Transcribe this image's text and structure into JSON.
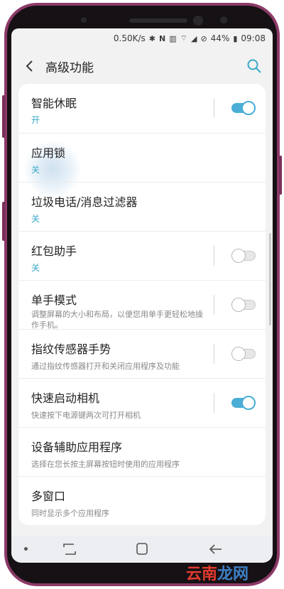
{
  "status_bar": {
    "speed": "0.50K/s",
    "battery": "44%",
    "time": "09:08"
  },
  "app_bar": {
    "title": "高级功能"
  },
  "settings": [
    {
      "title": "智能休眠",
      "subtitle": "开",
      "subtitle_style": "value",
      "toggle": "on"
    },
    {
      "title": "应用锁",
      "subtitle": "关",
      "subtitle_style": "value",
      "toggle": null
    },
    {
      "title": "垃圾电话/消息过滤器",
      "subtitle": "关",
      "subtitle_style": "value",
      "toggle": null
    },
    {
      "title": "红包助手",
      "subtitle": "关",
      "subtitle_style": "value",
      "toggle": "off"
    },
    {
      "title": "单手模式",
      "subtitle": "调整屏幕的大小和布局，以便您用单手更轻松地操作手机。",
      "subtitle_style": "desc",
      "toggle": "off"
    },
    {
      "title": "指纹传感器手势",
      "subtitle": "通过指纹传感器打开和关闭应用程序及功能",
      "subtitle_style": "desc",
      "toggle": "off"
    },
    {
      "title": "快速启动相机",
      "subtitle": "快速按下电源键两次可打开相机",
      "subtitle_style": "desc",
      "toggle": "on"
    },
    {
      "title": "设备辅助应用程序",
      "subtitle": "选择在您长按主屏幕按钮时使用的应用程序",
      "subtitle_style": "desc",
      "toggle": null
    },
    {
      "title": "多窗口",
      "subtitle": "同时显示多个应用程序",
      "subtitle_style": "desc",
      "toggle": null
    }
  ],
  "watermark": {
    "part1": "云南",
    "part2": "龙网"
  },
  "colors": {
    "accent": "#4aaed6",
    "value_text": "#3aa9c9",
    "phone_body": "#8c3a67"
  }
}
